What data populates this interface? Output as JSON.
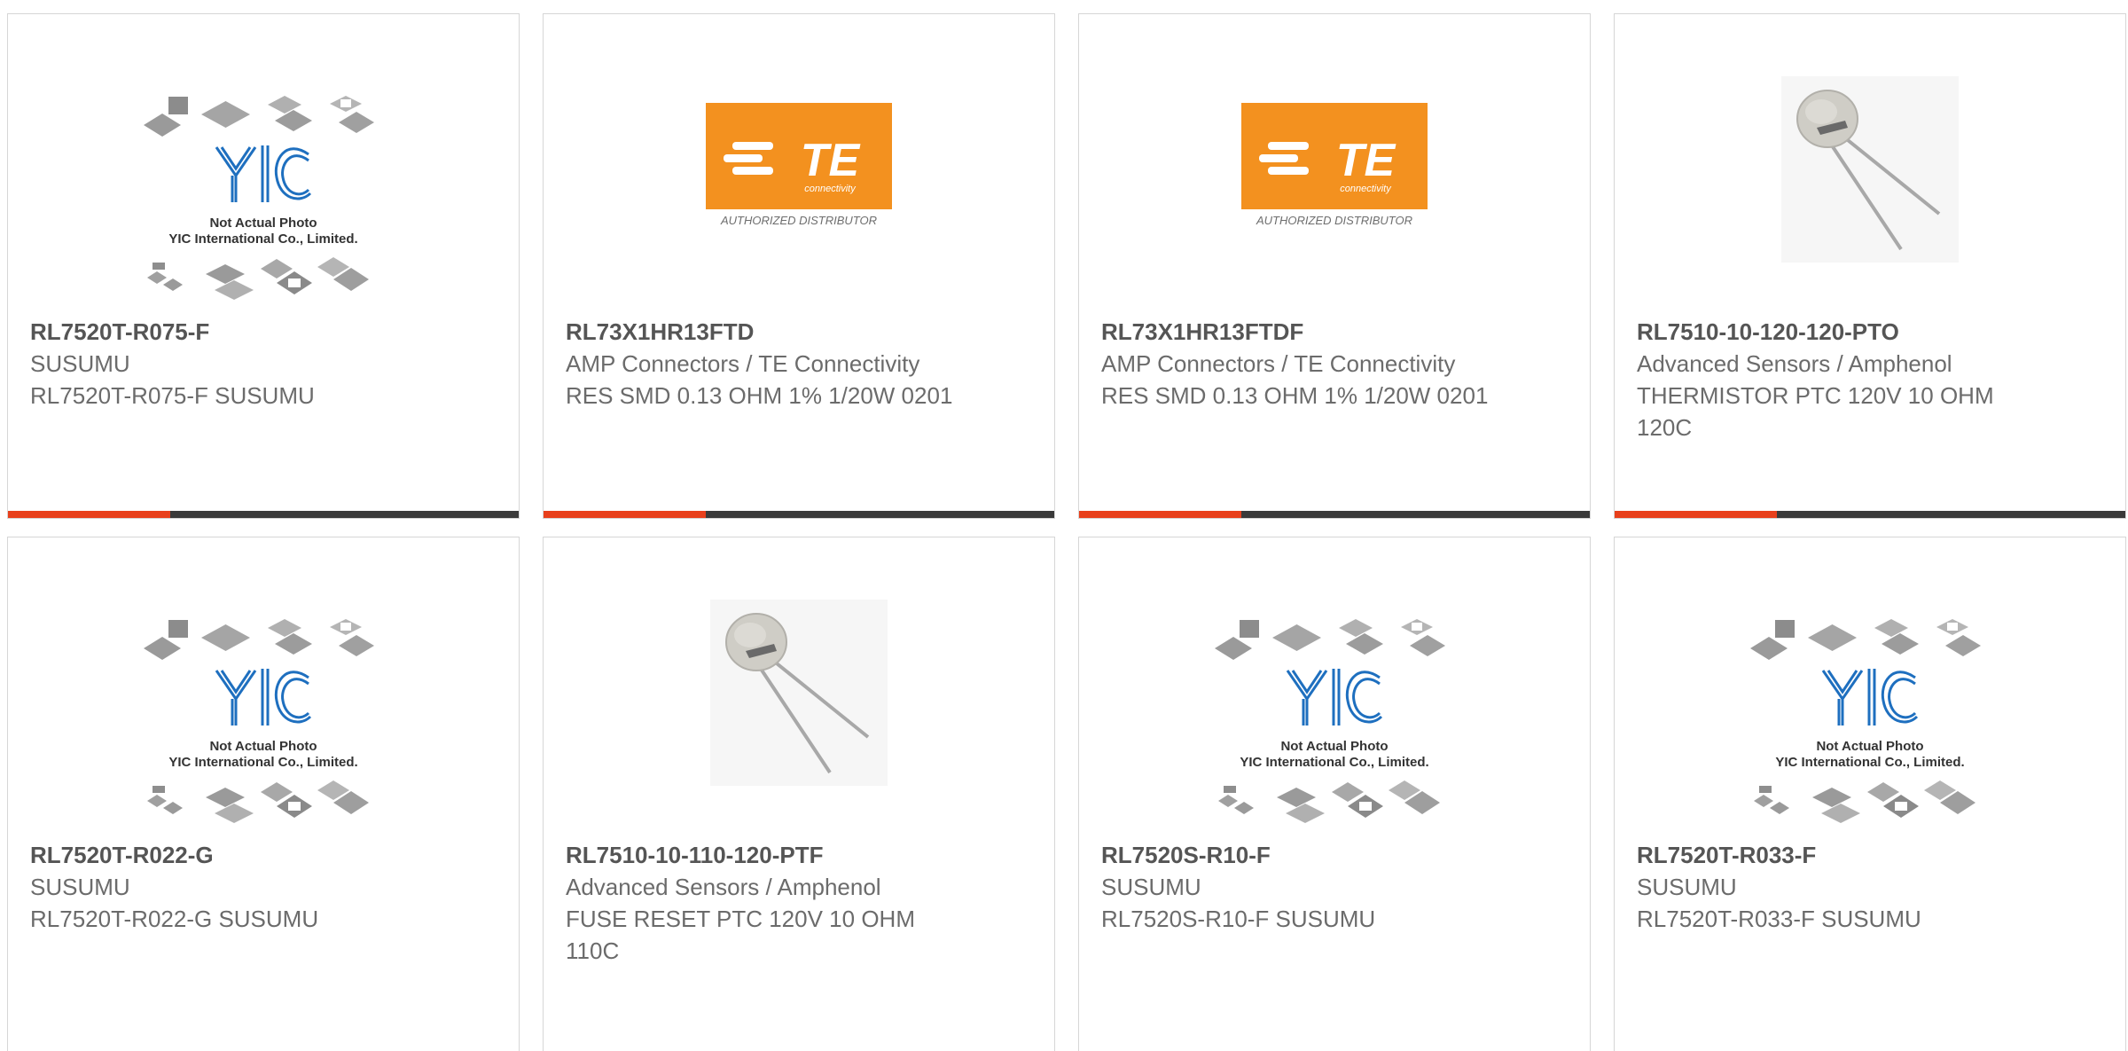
{
  "colors": {
    "accent": "#e8401c",
    "bar": "#3a3a3a",
    "te_orange": "#f3911f",
    "yic_blue": "#1e6fbf"
  },
  "image_text": {
    "yic_line1": "Not Actual Photo",
    "yic_line2": "YIC International Co., Limited.",
    "te_tagline": "AUTHORIZED DISTRIBUTOR"
  },
  "products": [
    {
      "part_number": "RL7520T-R075-F",
      "manufacturer": "SUSUMU",
      "description": "RL7520T-R075-F SUSUMU",
      "image": "yic-placeholder"
    },
    {
      "part_number": "RL73X1HR13FTD",
      "manufacturer": "AMP Connectors / TE Connectivity",
      "description": "RES SMD 0.13 OHM 1% 1/20W 0201",
      "image": "te-logo"
    },
    {
      "part_number": "RL73X1HR13FTDF",
      "manufacturer": "AMP Connectors / TE Connectivity",
      "description": "RES SMD 0.13 OHM 1% 1/20W 0201",
      "image": "te-logo"
    },
    {
      "part_number": "RL7510-10-120-120-PTO",
      "manufacturer": "Advanced Sensors / Amphenol",
      "description": "THERMISTOR PTC 120V 10 OHM 120C",
      "image": "thermistor"
    },
    {
      "part_number": "RL7520T-R022-G",
      "manufacturer": "SUSUMU",
      "description": "RL7520T-R022-G SUSUMU",
      "image": "yic-placeholder"
    },
    {
      "part_number": "RL7510-10-110-120-PTF",
      "manufacturer": "Advanced Sensors / Amphenol",
      "description": "FUSE RESET PTC 120V 10 OHM 110C",
      "image": "thermistor"
    },
    {
      "part_number": "RL7520S-R10-F",
      "manufacturer": "SUSUMU",
      "description": "RL7520S-R10-F SUSUMU",
      "image": "yic-placeholder"
    },
    {
      "part_number": "RL7520T-R033-F",
      "manufacturer": "SUSUMU",
      "description": "RL7520T-R033-F SUSUMU",
      "image": "yic-placeholder"
    }
  ]
}
